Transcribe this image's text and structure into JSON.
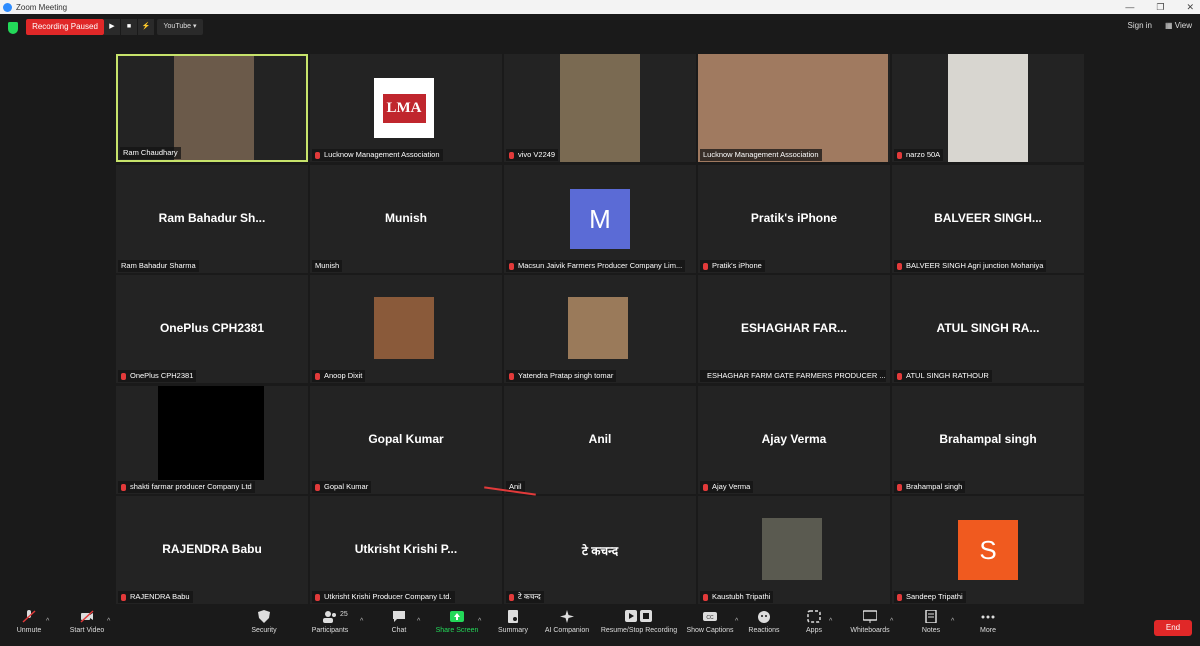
{
  "window": {
    "title": "Zoom Meeting"
  },
  "topbar": {
    "recording_label": "Recording Paused",
    "play_glyph": "▶",
    "stop_glyph": "■",
    "feed_glyph": "⚡",
    "stream_label": "YouTube ▾",
    "sign_in": "Sign in",
    "view_label": "View"
  },
  "tiles": [
    {
      "name": "Ram Chaudhary",
      "type": "video",
      "muted": false
    },
    {
      "name": "Lucknow Management Association",
      "type": "logo",
      "muted": true
    },
    {
      "name": "vivo V2249",
      "type": "video",
      "muted": true
    },
    {
      "name": "Lucknow Management Association",
      "type": "video",
      "muted": false
    },
    {
      "name": "narzo 50A",
      "type": "video",
      "muted": true
    },
    {
      "name": "Ram Bahadur Sharma",
      "display": "Ram Bahadur Sh...",
      "type": "text",
      "muted": false
    },
    {
      "name": "Munish",
      "display": "Munish",
      "type": "text",
      "muted": false
    },
    {
      "name": "Macsun Jaivik Farmers Producer Company Lim...",
      "avatar_letter": "M",
      "avatar_color": "#5b6bd6",
      "type": "avatar",
      "muted": true
    },
    {
      "name": "Pratik's iPhone",
      "display": "Pratik's iPhone",
      "type": "text",
      "muted": true
    },
    {
      "name": "BALVEER SINGH Agri junction Mohaniya",
      "display": "BALVEER SINGH...",
      "type": "text",
      "muted": true
    },
    {
      "name": "OnePlus CPH2381",
      "display": "OnePlus CPH2381",
      "type": "text",
      "muted": true
    },
    {
      "name": "Anoop Dixit",
      "type": "photo",
      "muted": true
    },
    {
      "name": "Yatendra Pratap singh tomar",
      "type": "photo",
      "muted": true
    },
    {
      "name": "ESHAGHAR FARM GATE FARMERS PRODUCER ...",
      "display": "ESHAGHAR FAR...",
      "type": "text",
      "muted": true
    },
    {
      "name": "ATUL SINGH RATHOUR",
      "display": "ATUL SINGH RA...",
      "type": "text",
      "muted": true
    },
    {
      "name": "shakti farmar producer Company Ltd",
      "type": "black",
      "muted": true
    },
    {
      "name": "Gopal Kumar",
      "display": "Gopal Kumar",
      "type": "text",
      "muted": true
    },
    {
      "name": "Anil",
      "display": "Anil",
      "type": "text",
      "muted": false
    },
    {
      "name": "Ajay Verma",
      "display": "Ajay Verma",
      "type": "text",
      "muted": true
    },
    {
      "name": "Brahampal singh",
      "display": "Brahampal singh",
      "type": "text",
      "muted": true
    },
    {
      "name": "RAJENDRA Babu",
      "display": "RAJENDRA Babu",
      "type": "text",
      "muted": true
    },
    {
      "name": "Utkrisht Krishi Producer Company Ltd.",
      "display": "Utkrisht Krishi P...",
      "type": "text",
      "muted": true
    },
    {
      "name": "टे कचन्द",
      "display": "टे कचन्द",
      "type": "text",
      "muted": true
    },
    {
      "name": "Kaustubh Tripathi",
      "type": "photo",
      "muted": true
    },
    {
      "name": "Sandeep Tripathi",
      "avatar_letter": "S",
      "avatar_color": "#f05a1f",
      "type": "avatar",
      "muted": true
    }
  ],
  "logo_text": "LMA",
  "toolbar": {
    "unmute": "Unmute",
    "start_video": "Start Video",
    "security": "Security",
    "participants": "Participants",
    "participant_count": "25",
    "chat": "Chat",
    "share_screen": "Share Screen",
    "summary": "Summary",
    "ai_companion": "AI Companion",
    "resume_recording": "Resume/Stop Recording",
    "show_captions": "Show Captions",
    "reactions": "Reactions",
    "apps": "Apps",
    "whiteboards": "Whiteboards",
    "notes": "Notes",
    "more": "More",
    "end": "End"
  },
  "colors": {
    "active_border": "#c7e36b",
    "end": "#e02828",
    "share_green": "#23d959"
  }
}
